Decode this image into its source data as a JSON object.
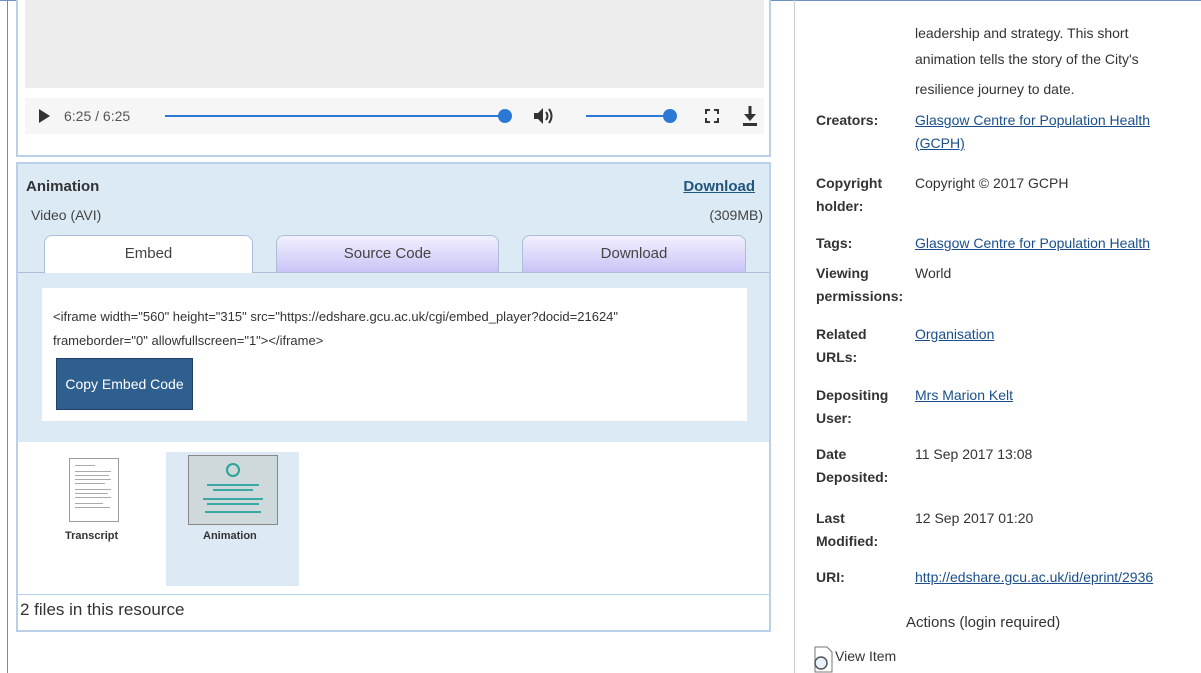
{
  "player": {
    "time": "6:25 / 6:25",
    "progress": 1.0,
    "volume": 1.0
  },
  "file": {
    "title": "Animation",
    "download_link": "Download",
    "type": "Video (AVI)",
    "size": "(309MB)",
    "tabs": [
      "Embed",
      "Source Code",
      "Download"
    ],
    "active_tab": "Embed",
    "embed_code": "<iframe width=\"560\" height=\"315\" src=\"https://edshare.gcu.ac.uk/cgi/embed_player?docid=21624\" frameborder=\"0\" allowfullscreen=\"1\"></iframe>",
    "copy_button": "Copy Embed Code"
  },
  "thumbnails": [
    {
      "label": "Transcript"
    },
    {
      "label": "Animation"
    }
  ],
  "file_count": "2 files in this resource",
  "description_tail": {
    "line1": "leadership and strategy. This short",
    "line2": "animation tells the story of the City's",
    "line3": "resilience journey to date."
  },
  "metadata": {
    "creators_label": "Creators:",
    "creators_value": "Glasgow Centre for Population Health (GCPH)",
    "copyright_label": "Copyright holder:",
    "copyright_value": "Copyright © 2017 GCPH",
    "tags_label": "Tags:",
    "tags_value": "Glasgow Centre for Population Health",
    "viewing_label": "Viewing permissions:",
    "viewing_value": "World",
    "related_label": "Related URLs:",
    "related_value": "Organisation",
    "depositing_label": "Depositing User:",
    "depositing_value": "Mrs Marion Kelt",
    "date_dep_label": "Date Deposited:",
    "date_dep_value": "11 Sep 2017 13:08",
    "last_mod_label": "Last Modified:",
    "last_mod_value": "12 Sep 2017 01:20",
    "uri_label": "URI:",
    "uri_value": "http://edshare.gcu.ac.uk/id/eprint/2936"
  },
  "actions_heading": "Actions (login required)",
  "view_item": "View Item",
  "colors": {
    "accent_blue": "#2b79d4",
    "link": "#1a4f8b",
    "button": "#2e5f8e",
    "panel_bg": "#dceaf5"
  }
}
